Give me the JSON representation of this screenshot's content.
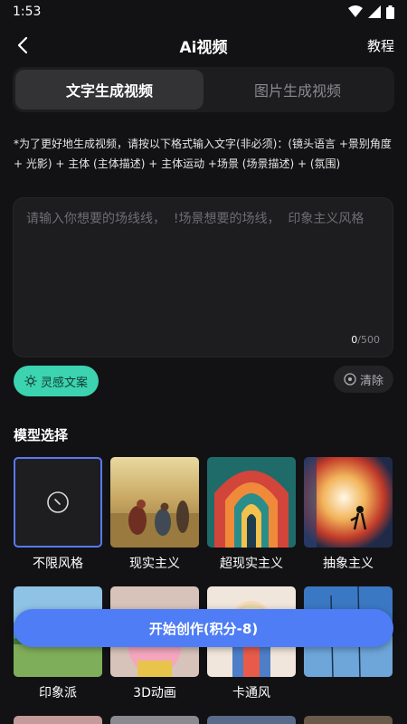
{
  "status": {
    "time": "1:53"
  },
  "nav": {
    "title": "Ai视频",
    "right_link": "教程"
  },
  "tabs": [
    {
      "label": "文字生成视频",
      "active": true
    },
    {
      "label": "图片生成视频",
      "active": false
    }
  ],
  "hint": "*为了更好地生成视频，请按以下格式输入文字(非必须)：(镜头语言 +景别角度+ 光影) + 主体 (主体描述) + 主体运动 +场景 (场景描述) + (氛围)",
  "prompt": {
    "placeholder": "请输入你想要的场线线，  !场景想要的场线，  印象主义风格",
    "value": "",
    "count": "0",
    "max": "/500"
  },
  "inspire_label": "灵感文案",
  "clear_label": "清除",
  "model_section_title": "模型选择",
  "models": [
    {
      "label": "不限风格",
      "selected": true
    },
    {
      "label": "现实主义",
      "selected": false
    },
    {
      "label": "超现实主义",
      "selected": false
    },
    {
      "label": "抽象主义",
      "selected": false
    },
    {
      "label": "印象派",
      "selected": false
    },
    {
      "label": "3D动画",
      "selected": false
    },
    {
      "label": "卡通风",
      "selected": false
    },
    {
      "label": "",
      "selected": false
    }
  ],
  "start_button": "开始创作(积分-8)",
  "colors": {
    "accent": "#4f7df5",
    "inspire": "#3bd3b0",
    "background": "#121214"
  }
}
